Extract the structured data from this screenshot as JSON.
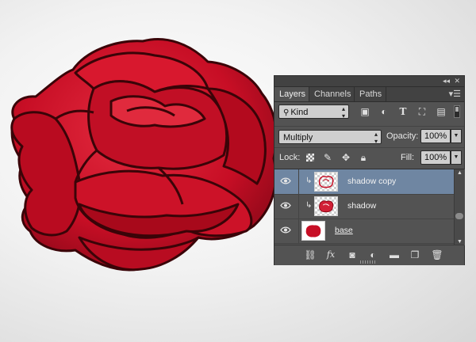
{
  "colors": {
    "rose_fill": "#c70e25",
    "rose_light": "#e42b3f",
    "rose_outline": "#3a0408",
    "panel_bg": "#535353",
    "selected_row": "#6f86a2"
  },
  "panel": {
    "tabs": [
      {
        "label": "Layers",
        "active": true
      },
      {
        "label": "Channels",
        "active": false
      },
      {
        "label": "Paths",
        "active": false
      }
    ],
    "filter": {
      "kind_label": "Kind",
      "icons": [
        "pixel-filter-icon",
        "adjustment-filter-icon",
        "type-filter-icon",
        "shape-filter-icon",
        "smart-object-filter-icon"
      ],
      "type_glyph": "T"
    },
    "blend_mode": "Multiply",
    "opacity_label": "Opacity:",
    "opacity_value": "100%",
    "lock_label": "Lock:",
    "fill_label": "Fill:",
    "fill_value": "100%",
    "layers": [
      {
        "name": "shadow copy",
        "selected": true,
        "clipped": true,
        "visible": true
      },
      {
        "name": "shadow",
        "selected": false,
        "clipped": true,
        "visible": true
      },
      {
        "name": "base",
        "selected": false,
        "clipped": false,
        "visible": true
      }
    ],
    "footer_icons": [
      "link-layers-icon",
      "fx-icon",
      "add-mask-icon",
      "adjustment-layer-icon",
      "new-group-icon",
      "new-layer-icon",
      "trash-icon"
    ],
    "fx_label": "fx"
  }
}
